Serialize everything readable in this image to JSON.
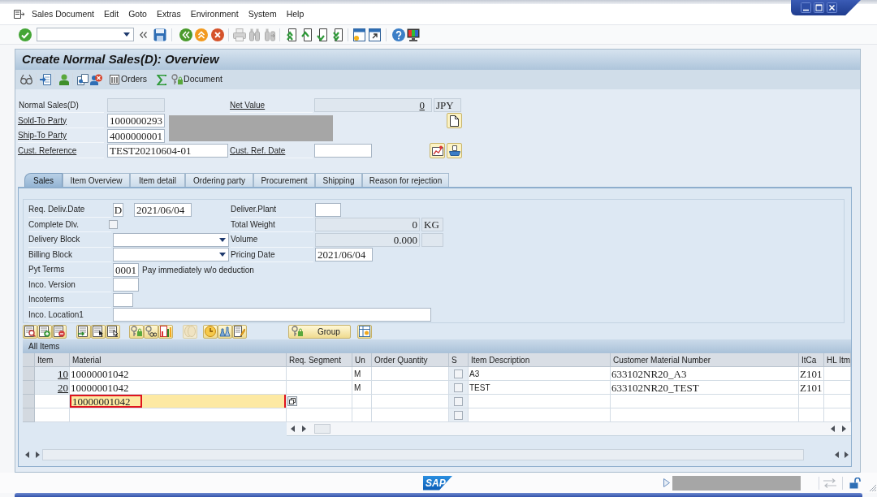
{
  "menu_bar": [
    "Sales Document",
    "Edit",
    "Goto",
    "Extras",
    "Environment",
    "System",
    "Help"
  ],
  "title": "Create Normal Sales(D): Overview",
  "app_toolbar": {
    "orders": "Orders",
    "document": "Document"
  },
  "header": {
    "document_type": {
      "label": "Normal Sales(D)"
    },
    "net_value": {
      "label": "Net Value",
      "value": "0",
      "currency": "JPY"
    },
    "sold_to_party": {
      "label": "Sold-To Party",
      "value": "1000000293"
    },
    "ship_to_party": {
      "label": "Ship-To Party",
      "value": "4000000001"
    },
    "cust_reference": {
      "label": "Cust. Reference",
      "value": "TEST20210604-01"
    },
    "cust_ref_date": {
      "label": "Cust. Ref. Date"
    }
  },
  "tabs": [
    {
      "label": "Sales",
      "selected": true
    },
    {
      "label": "Item Overview",
      "selected": false
    },
    {
      "label": "Item detail",
      "selected": false
    },
    {
      "label": "Ordering party",
      "selected": false
    },
    {
      "label": "Procurement",
      "selected": false
    },
    {
      "label": "Shipping",
      "selected": false
    },
    {
      "label": "Reason for rejection",
      "selected": false
    }
  ],
  "sales_tab": {
    "req_deliv_date": {
      "label": "Req. Deliv.Date",
      "format": "D",
      "value": "2021/06/04"
    },
    "deliver_plant": {
      "label": "Deliver.Plant"
    },
    "complete_dlv": {
      "label": "Complete Dlv.",
      "checked": false
    },
    "total_weight": {
      "label": "Total Weight",
      "value": "0",
      "unit": "KG"
    },
    "delivery_block": {
      "label": "Delivery Block"
    },
    "volume": {
      "label": "Volume",
      "value": "0.000"
    },
    "billing_block": {
      "label": "Billing Block"
    },
    "pricing_date": {
      "label": "Pricing Date",
      "value": "2021/06/04"
    },
    "pyt_terms": {
      "label": "Pyt Terms",
      "value": "0001",
      "description": "Pay immediately w/o deduction"
    },
    "inco_version": {
      "label": "Inco. Version"
    },
    "incoterms": {
      "label": "Incoterms"
    },
    "inco_location1": {
      "label": "Inco. Location1"
    }
  },
  "item_toolbar": {
    "group": "Group"
  },
  "items_table": {
    "title": "All Items",
    "columns": [
      "Item",
      "Material",
      "Req. Segment",
      "Un",
      "Order Quantity",
      "S",
      "Item Description",
      "Customer Material Number",
      "ItCa",
      "HL Itm"
    ],
    "rows": [
      {
        "item": "10",
        "material": "10000001042",
        "unit": "M",
        "checked": false,
        "description": "A3",
        "customer_material": "633102NR20_A3",
        "item_category": "Z101",
        "focused": false,
        "highlighted": false
      },
      {
        "item": "20",
        "material": "10000001042",
        "unit": "M",
        "checked": false,
        "description": "TEST",
        "customer_material": "633102NR20_TEST",
        "item_category": "Z101",
        "focused": false,
        "highlighted": false
      },
      {
        "material": "10000001042",
        "checked": false,
        "focused": true,
        "highlighted": true
      },
      {
        "checked": false,
        "focused": false,
        "highlighted": false
      }
    ]
  },
  "status_bar": {
    "logo": "SAP"
  }
}
